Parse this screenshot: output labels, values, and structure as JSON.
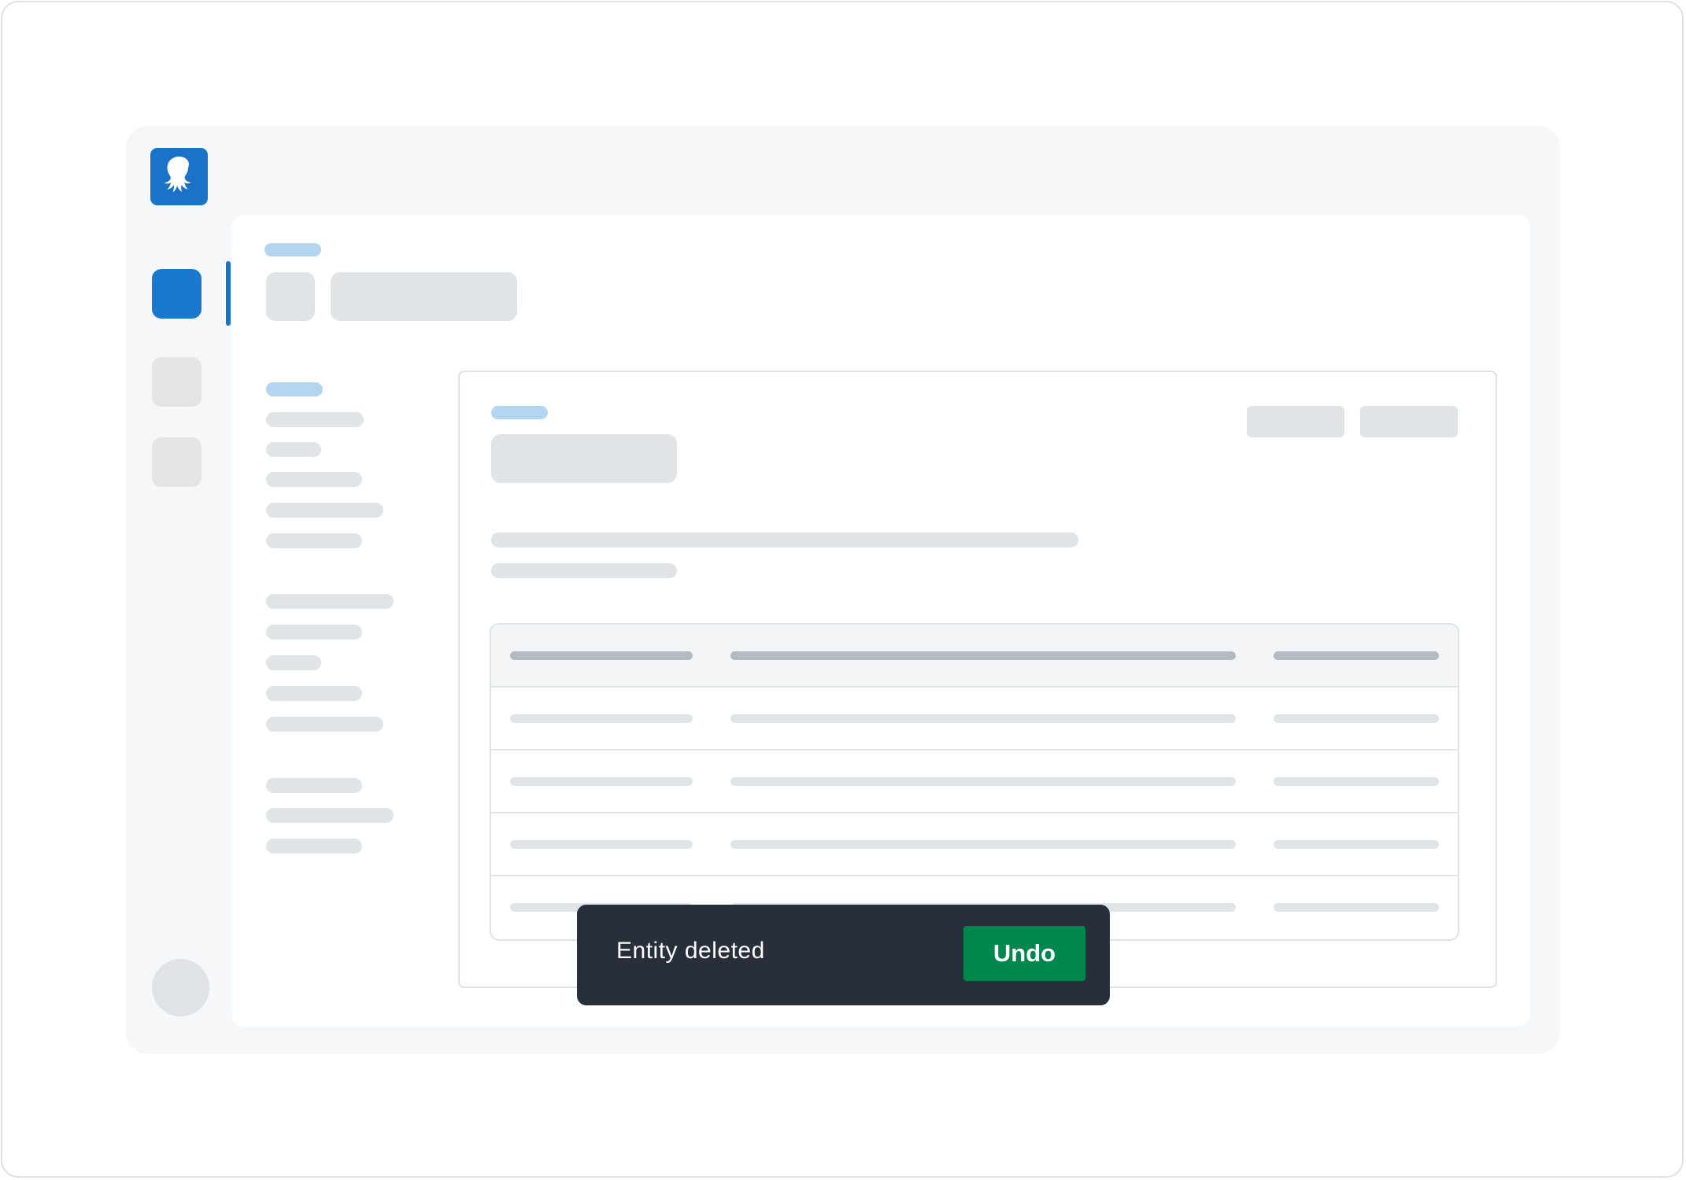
{
  "logo": {
    "icon": "octopus-logo-icon",
    "color": "#1a73c8"
  },
  "navigation": {
    "items": [
      {
        "icon": "nav-item-placeholder-icon",
        "active": true,
        "color": "#1a78cf"
      },
      {
        "icon": "nav-item-placeholder-icon",
        "active": false
      },
      {
        "icon": "nav-item-placeholder-icon",
        "active": false
      }
    ],
    "avatar_icon": "avatar-placeholder-icon"
  },
  "toast": {
    "message": "Entity deleted",
    "action_label": "Undo",
    "background": "#272f3a",
    "action_color": "#00874d"
  },
  "colors": {
    "accent": "#1a73c8",
    "placeholder": "#e1e4e7",
    "placeholder_accent": "#b4d5ef",
    "table_header_placeholder": "#b4bac3",
    "success": "#00874d"
  }
}
